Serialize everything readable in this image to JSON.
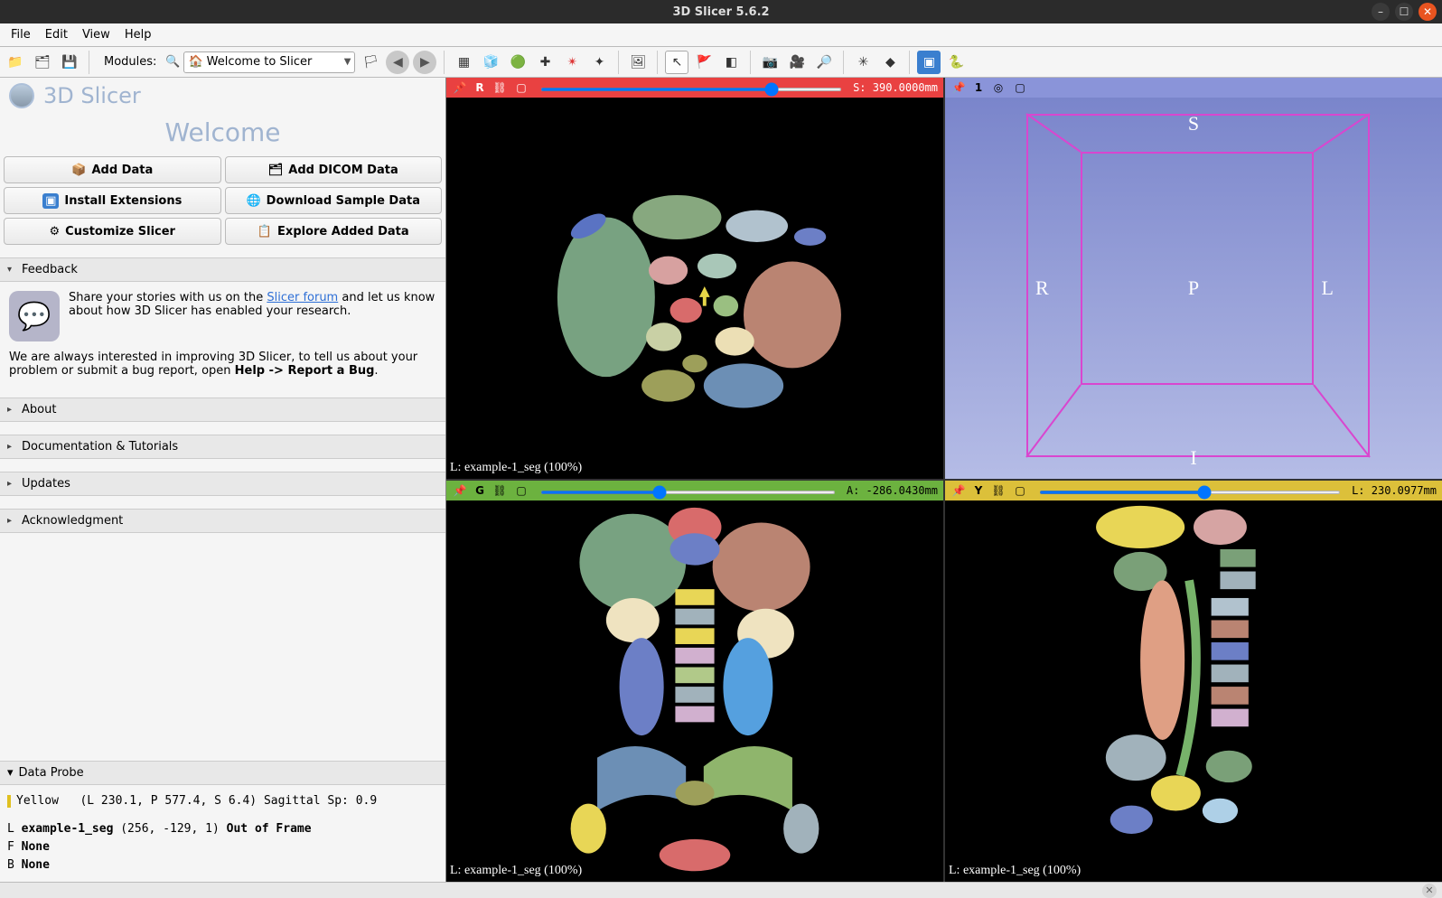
{
  "window": {
    "title": "3D Slicer 5.6.2"
  },
  "menu": {
    "file": "File",
    "edit": "Edit",
    "view": "View",
    "help": "Help"
  },
  "toolbar": {
    "modules_label": "Modules:",
    "module_selected": "Welcome to Slicer"
  },
  "app": {
    "name": "3D Slicer",
    "welcome": "Welcome"
  },
  "buttons": {
    "add_data": "Add Data",
    "add_dicom": "Add DICOM Data",
    "install_ext": "Install Extensions",
    "download_sample": "Download Sample Data",
    "customize": "Customize Slicer",
    "explore": "Explore Added Data"
  },
  "sections": {
    "feedback": "Feedback",
    "about": "About",
    "docs": "Documentation & Tutorials",
    "updates": "Updates",
    "ack": "Acknowledgment"
  },
  "feedback": {
    "text_pre": "Share your stories with us on the ",
    "link": "Slicer forum",
    "text_post": " and let us know about how 3D Slicer has enabled your research.",
    "para2_pre": "We are always interested in improving 3D Slicer, to tell us about your problem or submit a bug report, open ",
    "para2_bold": "Help -> Report a Bug",
    "para2_post": "."
  },
  "views": {
    "red": {
      "letter": "R",
      "readout": "S: 390.0000mm",
      "label": "L: example-1_seg (100%)"
    },
    "green": {
      "letter": "G",
      "readout": "A: -286.0430mm",
      "label": "L: example-1_seg (100%)"
    },
    "yellow": {
      "letter": "Y",
      "readout": "L: 230.0977mm",
      "label": "L: example-1_seg (100%)"
    },
    "threeD": {
      "letter": "1",
      "labels": {
        "s": "S",
        "i": "I",
        "r": "R",
        "l": "L",
        "p": "P"
      }
    }
  },
  "dataprobe": {
    "title": "Data Probe",
    "line1_view": "Yellow",
    "line1_coords": "(L 230.1, P 577.4, S 6.4)  Sagittal Sp: 0.9",
    "L_pre": "L",
    "L_bold": "example-1_seg",
    "L_mid": "(256,  -129,    1)",
    "L_bold2": "Out of Frame",
    "F": "F",
    "F_val": "None",
    "B": "B",
    "B_val": "None"
  }
}
